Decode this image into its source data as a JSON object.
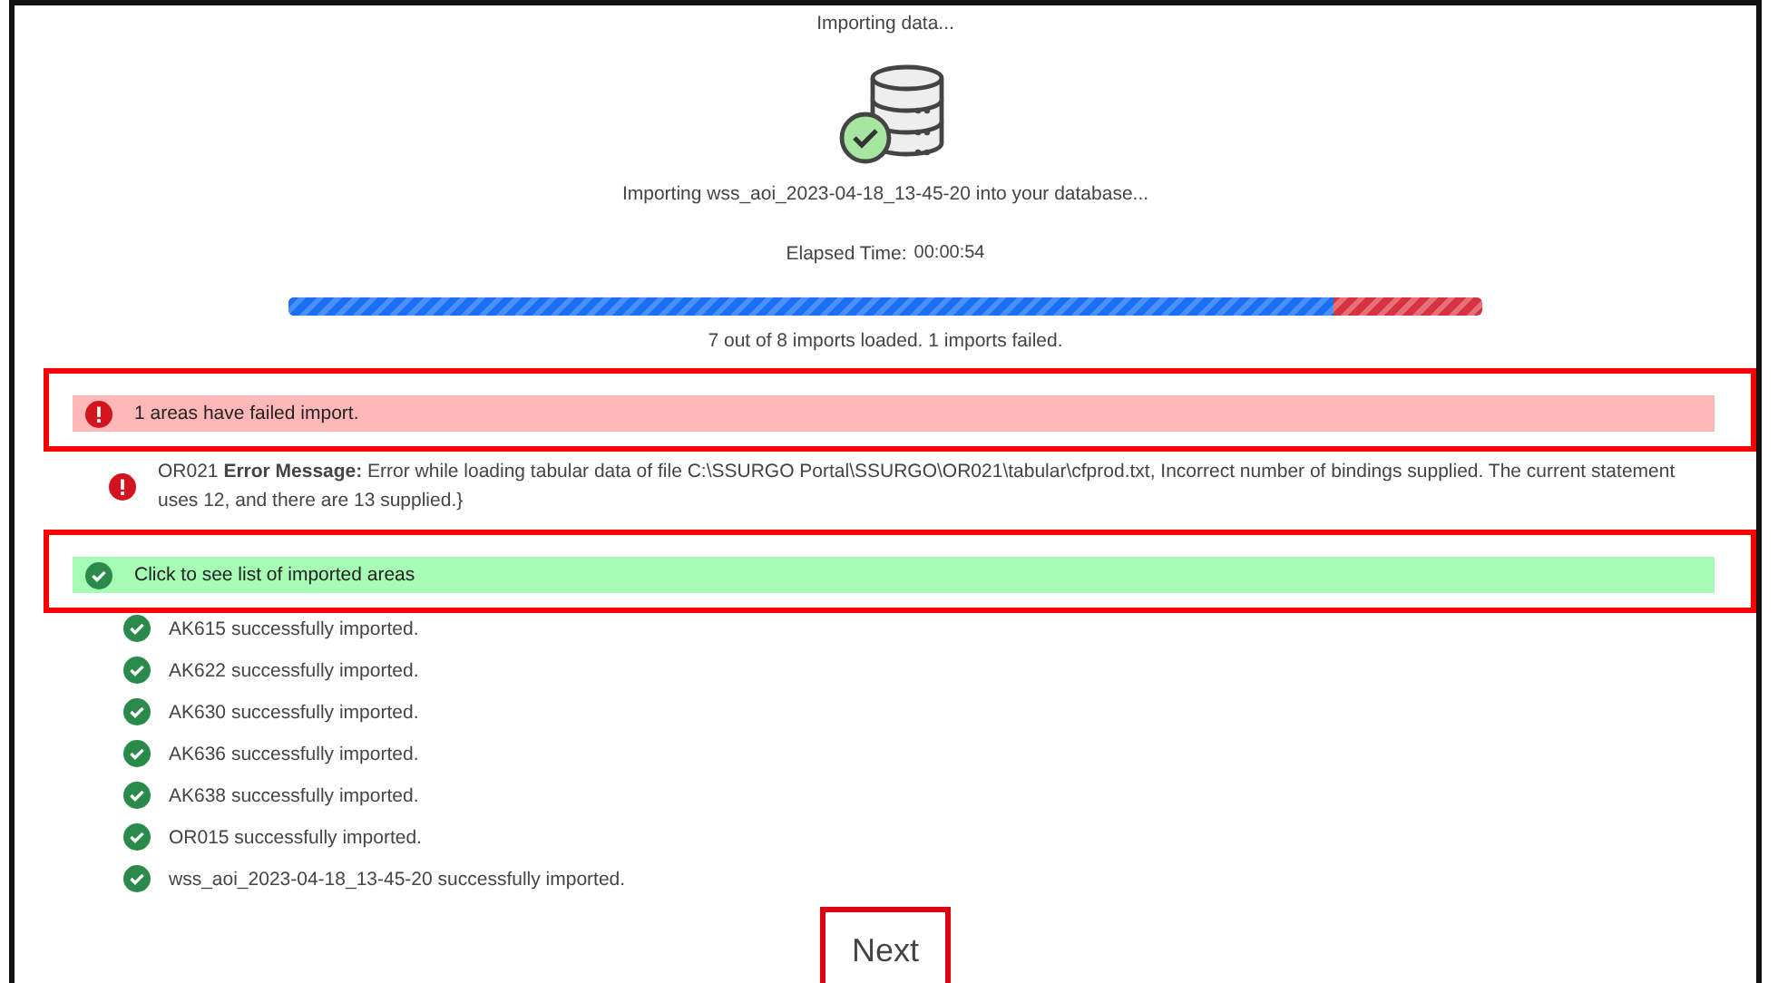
{
  "header": {
    "title": "Importing data...",
    "message": "Importing wss_aoi_2023-04-18_13-45-20 into your database...",
    "elapsed_label": "Elapsed Time:",
    "elapsed_value": "00:00:54"
  },
  "progress": {
    "level": 0.875,
    "summary": "7 out of 8 imports loaded. 1 imports failed."
  },
  "failure_banner": {
    "text": "1 areas have failed import.",
    "highlighted": true
  },
  "errors": [
    {
      "text": "OR021 **Error Message:** Error while loading tabular data of file C:\\SSURGO Portal\\SSURGO\\OR021\\tabular\\cfprod.txt, Incorrect number of bindings supplied. The current statement uses 12, and there are 13 supplied.}"
    }
  ],
  "success_banner": {
    "text": "Click to see list of imported areas",
    "highlighted": true
  },
  "imported": [
    {
      "text": "AK615 successfully imported."
    },
    {
      "text": "AK622 successfully imported."
    },
    {
      "text": "AK630 successfully imported."
    },
    {
      "text": "AK636 successfully imported."
    },
    {
      "text": "AK638 successfully imported."
    },
    {
      "text": "OR015 successfully imported."
    },
    {
      "text": "wss_aoi_2023-04-18_13-45-20 successfully imported."
    }
  ],
  "next_button": {
    "label": "Next",
    "highlighted": true
  }
}
